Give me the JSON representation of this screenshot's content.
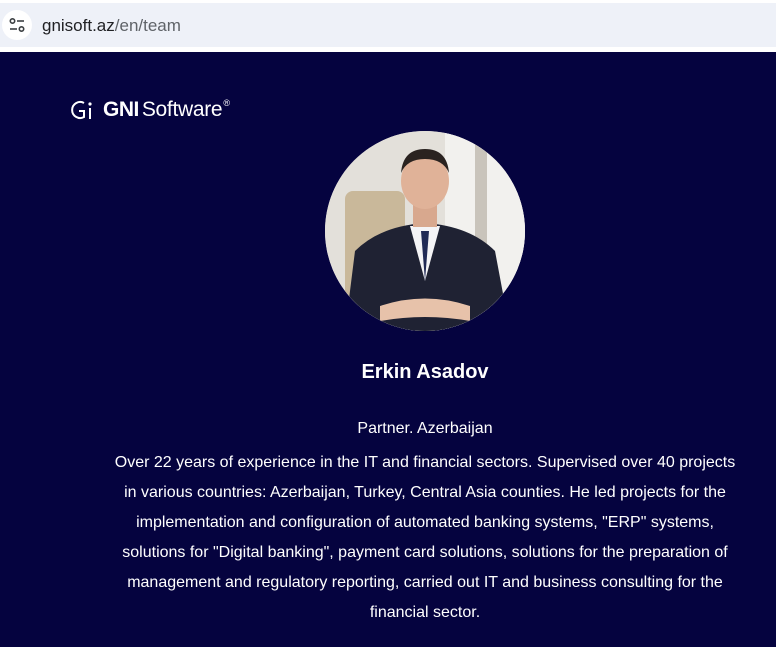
{
  "browser": {
    "url_host": "gnisoft.az",
    "url_path": "/en/team",
    "site_info_icon": "tune-icon"
  },
  "logo": {
    "mark": "Gi",
    "bold": "GNI",
    "regular": "Software",
    "reg": "®"
  },
  "member": {
    "name": "Erkin Asadov",
    "role": "Partner. Azerbaijan",
    "bio": "Over 22 years of experience in the IT and financial sectors. Supervised over 40 projects in various countries: Azerbaijan, Turkey, Central Asia counties. He led projects for the implementation and configuration of automated banking systems, \"ERP\" systems, solutions for \"Digital banking\", payment card solutions, solutions for the preparation of management and regulatory reporting, carried out IT and business consulting for the financial sector."
  },
  "colors": {
    "background": "#05033f",
    "text": "#ffffff",
    "url_bar": "#eef1f8"
  }
}
